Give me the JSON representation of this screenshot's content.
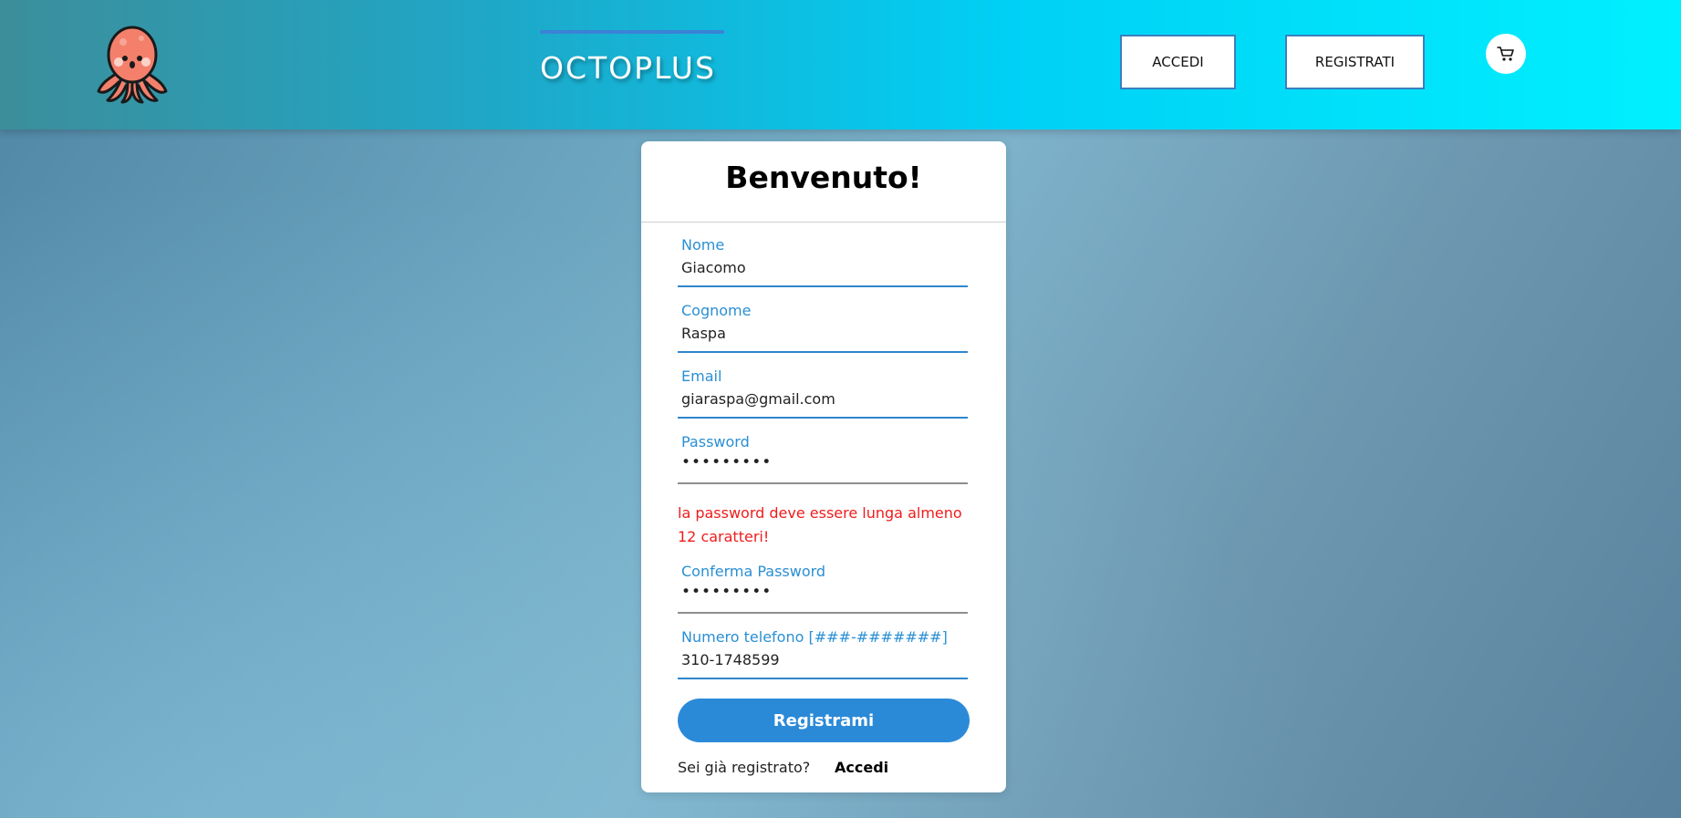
{
  "header": {
    "brand": "OCTOPLUS",
    "accedi_label": "ACCEDI",
    "registrati_label": "REGISTRATI",
    "logo_icon": "octopus-logo-icon",
    "cart_icon": "cart-icon"
  },
  "form": {
    "title": "Benvenuto!",
    "fields": [
      {
        "label": "Nome",
        "value": "Giacomo"
      },
      {
        "label": "Cognome",
        "value": "Raspa"
      },
      {
        "label": "Email",
        "value": "giaraspa@gmail.com"
      },
      {
        "label": "Password",
        "value": "•••••••••"
      },
      {
        "label": "Conferma Password",
        "value": "•••••••••"
      },
      {
        "label": "Numero telefono [###-#######]",
        "value": "310-1748599"
      }
    ],
    "error": "la password deve essere lunga almeno 12 caratteri!",
    "submit_label": "Registrami",
    "footer_question": "Sei già registrato?",
    "footer_link": "Accedi"
  },
  "colors": {
    "accent": "#2b8ad8",
    "error": "#ef1c1c",
    "header_start": "#3c8e9a",
    "header_end": "#00f0ff",
    "octopus": "#f4806c"
  }
}
